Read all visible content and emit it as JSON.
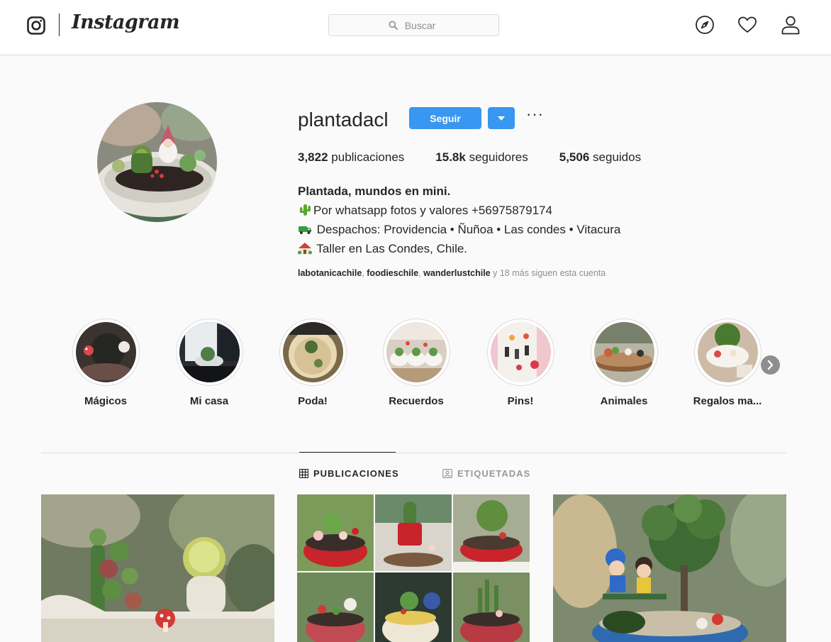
{
  "brand": {
    "wordmark": "Instagram"
  },
  "search": {
    "placeholder": "Buscar"
  },
  "nav_icons": [
    "explore-compass-icon",
    "activity-heart-icon",
    "profile-person-icon"
  ],
  "profile": {
    "username": "plantadacl",
    "follow_label": "Seguir",
    "stats": {
      "posts_count": "3,822",
      "posts_label": "publicaciones",
      "followers_count": "15.8k",
      "followers_label": "seguidores",
      "following_count": "5,506",
      "following_label": "seguidos"
    },
    "bio": {
      "name": "Plantada, mundos en mini.",
      "line1": "Por whatsapp fotos y valores +56975879174",
      "line2": " Despachos: Providencia • Ñuñoa • Las condes • Vitacura",
      "line3": " Taller en Las Condes, Chile."
    },
    "followed_by": {
      "acct1": "labotanicachile",
      "acct2": "foodieschile",
      "acct3": "wanderlustchile",
      "sep": ", ",
      "more": " y 18 más siguen esta cuenta"
    }
  },
  "highlights": [
    {
      "label": "Mágicos"
    },
    {
      "label": "Mi casa"
    },
    {
      "label": "Poda!"
    },
    {
      "label": "Recuerdos"
    },
    {
      "label": "Pins!"
    },
    {
      "label": "Animales"
    },
    {
      "label": "Regalos ma..."
    }
  ],
  "tabs": [
    {
      "label": "PUBLICACIONES",
      "active": true
    },
    {
      "label": "ETIQUETADAS",
      "active": false
    }
  ],
  "colors": {
    "accent": "#3897f0",
    "text": "#262626",
    "muted": "#8e8e8e",
    "border": "#dbdbdb",
    "background": "#fafafa"
  }
}
